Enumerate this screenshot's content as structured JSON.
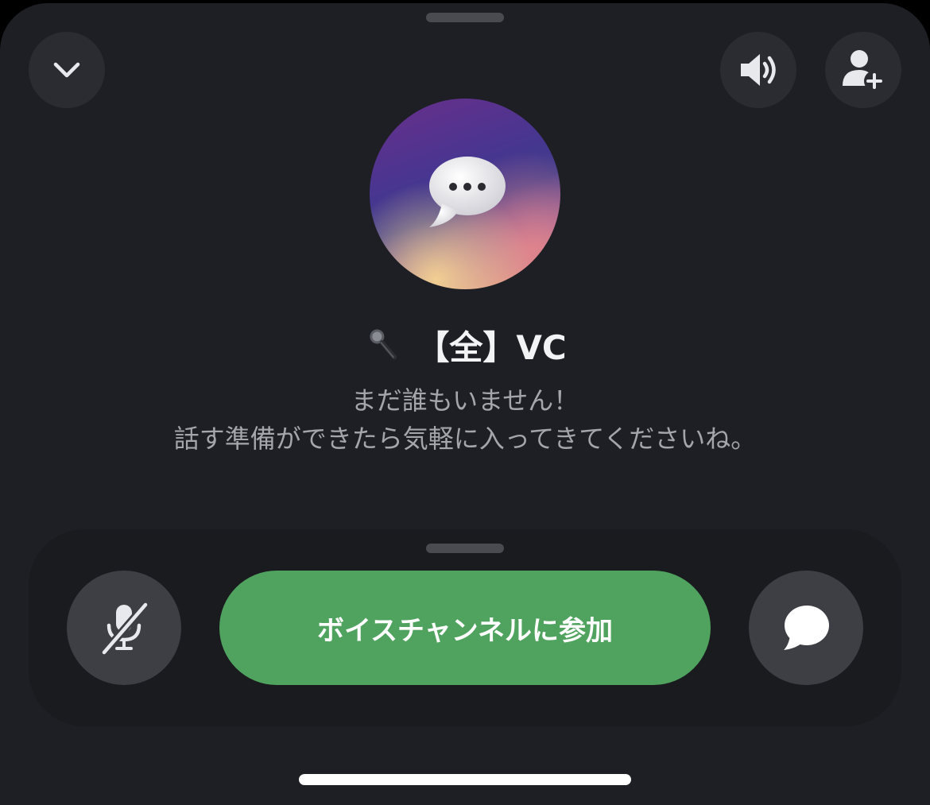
{
  "channel": {
    "emoji_icon": "microphone-icon",
    "name": "【全】VC",
    "avatar_icon": "speech-bubble-icon"
  },
  "empty_state": {
    "line1": "まだ誰もいません！",
    "line2": "話す準備ができたら気軽に入ってきてくださいね。"
  },
  "actions": {
    "join_label": "ボイスチャンネルに参加"
  },
  "colors": {
    "background": "#1e1f24",
    "join_button": "#4fa35f",
    "circle_button": "#2b2c31",
    "control_button": "#3e3f44"
  }
}
